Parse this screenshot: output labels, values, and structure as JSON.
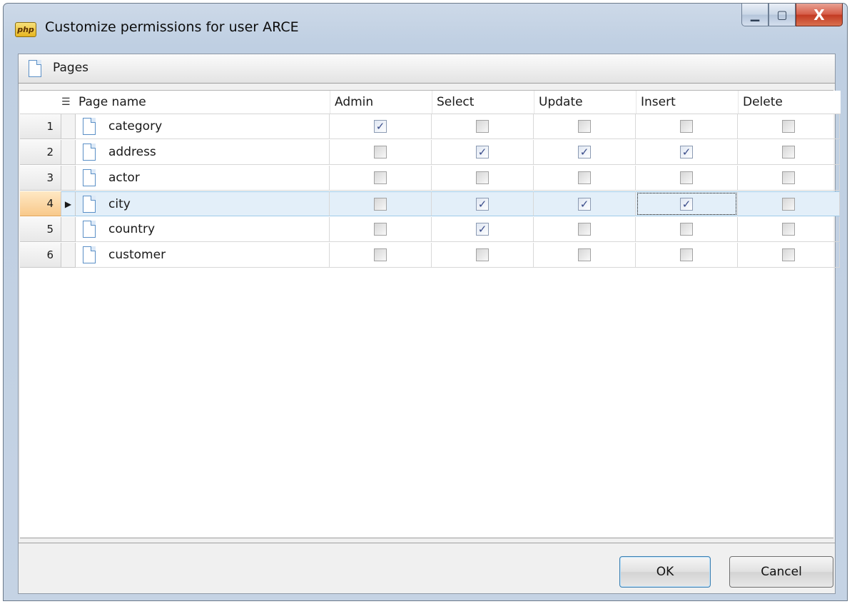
{
  "window": {
    "app_icon": "php",
    "title": "Customize permissions for user ARCE",
    "minimize": "▁",
    "maximize": "▢",
    "close": "X"
  },
  "pages_bar": {
    "label": "Pages"
  },
  "grid": {
    "columns": [
      "Page name",
      "Admin",
      "Select",
      "Update",
      "Insert",
      "Delete"
    ],
    "rows": [
      {
        "num": "1",
        "name": "category",
        "admin": true,
        "select": false,
        "update": false,
        "insert": false,
        "delete": false
      },
      {
        "num": "2",
        "name": "address",
        "admin": false,
        "select": true,
        "update": true,
        "insert": true,
        "delete": false
      },
      {
        "num": "3",
        "name": "actor",
        "admin": false,
        "select": false,
        "update": false,
        "insert": false,
        "delete": false
      },
      {
        "num": "4",
        "name": "city",
        "admin": false,
        "select": true,
        "update": true,
        "insert": true,
        "delete": false
      },
      {
        "num": "5",
        "name": "country",
        "admin": false,
        "select": true,
        "update": false,
        "insert": false,
        "delete": false
      },
      {
        "num": "6",
        "name": "customer",
        "admin": false,
        "select": false,
        "update": false,
        "insert": false,
        "delete": false
      }
    ],
    "selected_row": "4",
    "focused_cell": "insert",
    "row_indicator": "▶"
  },
  "buttons": {
    "ok": "OK",
    "cancel": "Cancel"
  }
}
